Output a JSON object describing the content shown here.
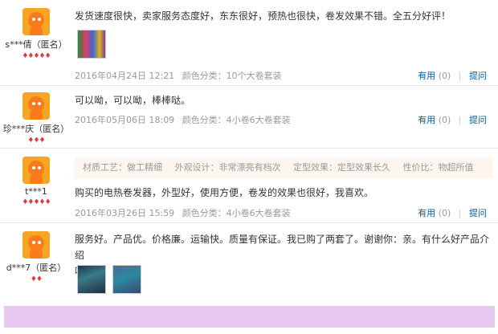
{
  "reviews": [
    {
      "user": "s***倩（匿名）",
      "level": "♦♦♦♦♦",
      "text": "发货速度很快，卖家服务态度好，东东很好，预热也很快，卷发效果不错。全五分好评！",
      "date": "2016年04月24日 12:21",
      "color": "颜色分类：10个大卷套装",
      "useful_label": "有用",
      "useful_count": "(0)",
      "reply_label": "提问"
    },
    {
      "user": "珍***庆（匿名）",
      "level": "♦♦♦",
      "text": "可以呦，可以呦，棒棒哒。",
      "date": "2016年05月06日 18:09",
      "color": "颜色分类：4小卷6大卷套装",
      "useful_label": "有用",
      "useful_count": "(0)",
      "reply_label": "提问"
    },
    {
      "user": "t***1",
      "level": "♦♦♦♦♦",
      "tags": [
        "材质工艺：做工精细",
        "外观设计：非常漂亮有档次",
        "定型效果：定型效果长久",
        "性价比：物超所值"
      ],
      "text": "购买的电热卷发器，外型好，使用方便，卷发的效果也很好，我喜欢。",
      "date": "2016年03月26日 15:59",
      "color": "颜色分类：4小卷6大卷套装",
      "useful_label": "有用",
      "useful_count": "(0)",
      "reply_label": "提问"
    },
    {
      "user": "d***7（匿名）",
      "level": "♦♦",
      "text_line1": "服务好。产品优。价格廉。运输快。质量有保证。我已购了两套了。谢谢你：亲。有什么好产品介绍",
      "text_line2": "哦。"
    }
  ],
  "colors": {
    "link": "#005ea7",
    "muted": "#999999",
    "tagbar_bg": "#fdf6ee",
    "footer_bg": "#e8c8f0"
  }
}
